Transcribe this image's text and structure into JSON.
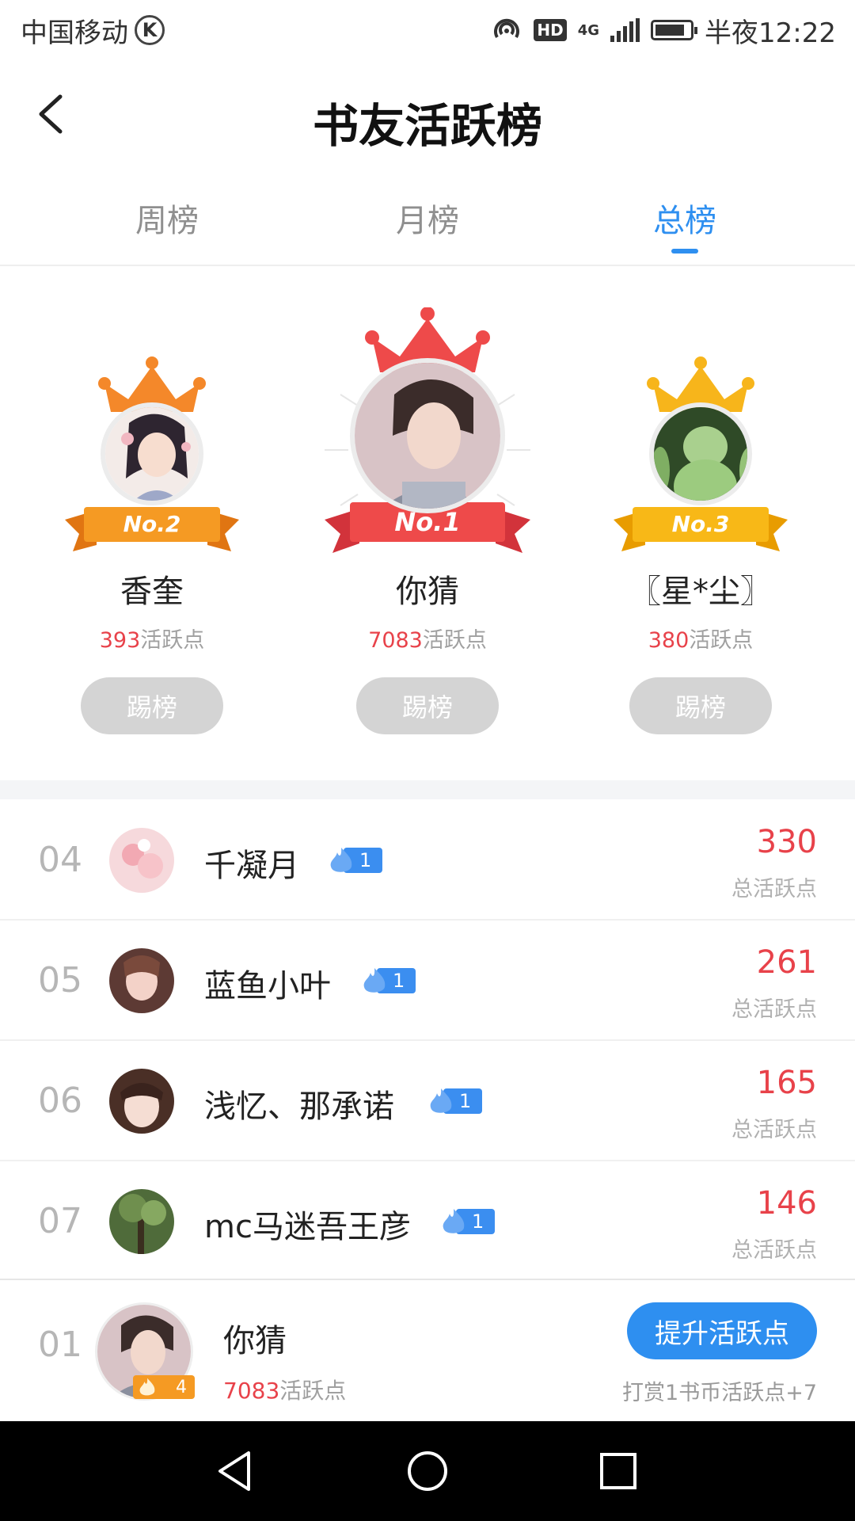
{
  "status_bar": {
    "carrier": "中国移动",
    "carrier_badge": "K",
    "hd": "HD",
    "network": "4G",
    "time": "半夜12:22"
  },
  "header": {
    "title": "书友活跃榜"
  },
  "tabs": [
    {
      "label": "周榜",
      "active": false
    },
    {
      "label": "月榜",
      "active": false
    },
    {
      "label": "总榜",
      "active": true
    }
  ],
  "podium": {
    "first": {
      "badge": "No.1",
      "name": "你猜",
      "points": "7083",
      "points_suffix": "活跃点",
      "button": "踢榜",
      "crown_color": "#ee4a4a"
    },
    "second": {
      "badge": "No.2",
      "name": "香奎",
      "points": "393",
      "points_suffix": "活跃点",
      "button": "踢榜",
      "crown_color": "#f4882a"
    },
    "third": {
      "badge": "No.3",
      "name": "〖星*尘〗",
      "points": "380",
      "points_suffix": "活跃点",
      "button": "踢榜",
      "crown_color": "#f7b51b"
    }
  },
  "list": [
    {
      "rank": "04",
      "name": "千凝月",
      "level": "1",
      "score": "330",
      "score_label": "总活跃点"
    },
    {
      "rank": "05",
      "name": "蓝鱼小叶",
      "level": "1",
      "score": "261",
      "score_label": "总活跃点"
    },
    {
      "rank": "06",
      "name": "浅忆、那承诺",
      "level": "1",
      "score": "165",
      "score_label": "总活跃点"
    },
    {
      "rank": "07",
      "name": "mc马迷吾王彦",
      "level": "1",
      "score": "146",
      "score_label": "总活跃点"
    }
  ],
  "me": {
    "rank": "01",
    "name": "你猜",
    "level": "4",
    "points": "7083",
    "points_suffix": "活跃点",
    "boost_button": "提升活跃点",
    "tip": "打赏1书币活跃点+7"
  },
  "colors": {
    "accent": "#2e8ff0",
    "score_red": "#e8424a",
    "muted": "#a0a0a0"
  }
}
